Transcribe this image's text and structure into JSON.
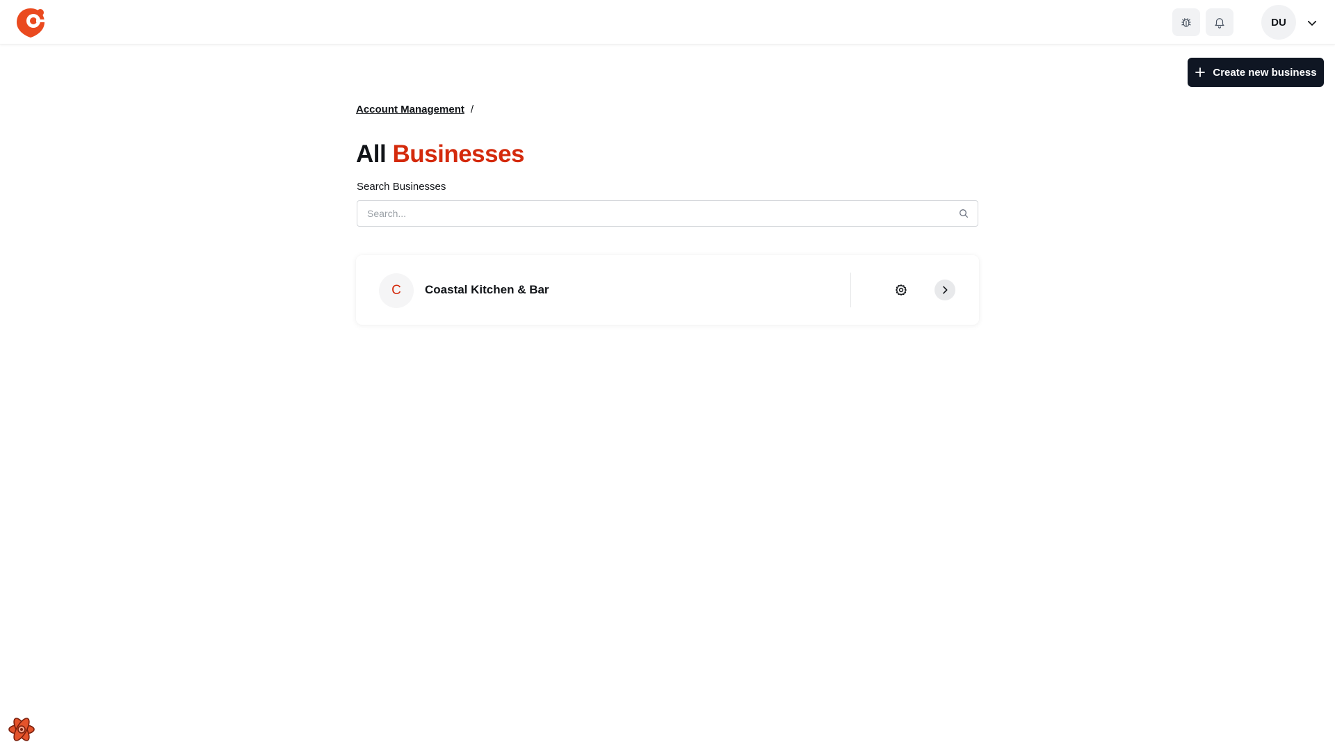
{
  "app": {
    "logo_icon": "brand-logo-icon",
    "accent_color": "#d42a0c",
    "dark_color": "#0f1623"
  },
  "header": {
    "debug_icon": "bug-icon",
    "notifications_icon": "bell-icon",
    "user_initials": "DU",
    "user_menu_icon": "chevron-down-icon"
  },
  "actions": {
    "create_label": "Create new business",
    "create_icon": "plus-icon"
  },
  "breadcrumb": {
    "items": [
      "Account Management"
    ],
    "separator": "/"
  },
  "page": {
    "title_prefix": "All",
    "title_accent": "Businesses"
  },
  "search": {
    "label": "Search Businesses",
    "placeholder": "Search...",
    "value": ""
  },
  "businesses": [
    {
      "initial": "C",
      "name": "Coastal Kitchen & Bar",
      "settings_icon": "gear-icon",
      "open_icon": "chevron-right-icon"
    }
  ]
}
